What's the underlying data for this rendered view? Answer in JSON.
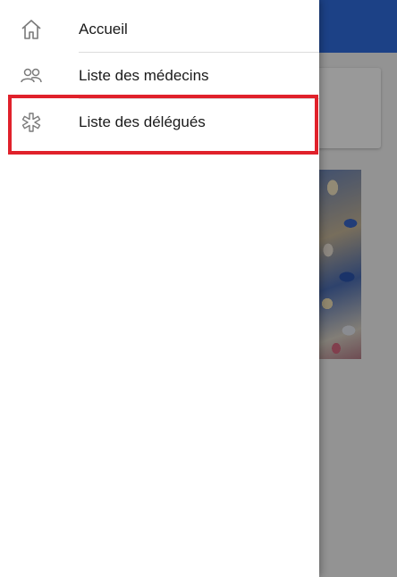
{
  "menu": {
    "items": [
      {
        "label": "Accueil",
        "icon": "home-icon"
      },
      {
        "label": "Liste des médecins",
        "icon": "people-icon"
      },
      {
        "label": "Liste des délégués",
        "icon": "asterisk-icon"
      }
    ]
  },
  "highlight": {
    "target": "Liste des délégués",
    "color": "#e0212b"
  },
  "colors": {
    "header": "#2f6de0",
    "icon": "#7a7a7a",
    "text": "#1a1a1a"
  }
}
